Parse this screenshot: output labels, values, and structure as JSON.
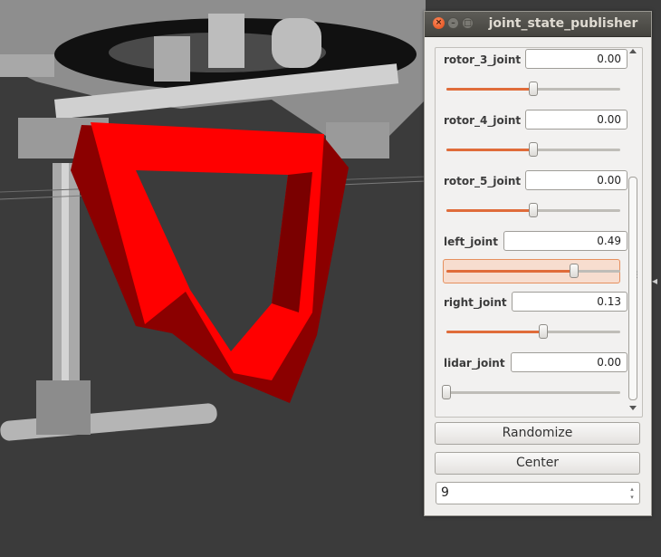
{
  "window": {
    "title": "joint_state_publisher",
    "close_glyph": "×",
    "min_glyph": "–",
    "max_glyph": "□"
  },
  "joints": [
    {
      "name": "rotor_3_joint",
      "value": "0.00",
      "level": 0.5
    },
    {
      "name": "rotor_4_joint",
      "value": "0.00",
      "level": 0.5
    },
    {
      "name": "rotor_5_joint",
      "value": "0.00",
      "level": 0.5
    },
    {
      "name": "left_joint",
      "value": "0.49",
      "level": 0.735,
      "focused": true
    },
    {
      "name": "right_joint",
      "value": "0.13",
      "level": 0.555
    },
    {
      "name": "lidar_joint",
      "value": "0.00",
      "level": 0.0
    }
  ],
  "buttons": {
    "randomize": "Randomize",
    "center": "Center"
  },
  "spinbox": {
    "value": "9",
    "up_glyph": "▴",
    "down_glyph": "▾"
  },
  "icons": {
    "splitter": "splitter-grip-icon",
    "scroll_up": "scroll-up-arrow-icon",
    "scroll_down": "scroll-down-arrow-icon"
  },
  "colors": {
    "accent": "#e06c3a",
    "robot_frame": "#ff0000",
    "titlebar": "#4f4e4a",
    "viewport_bg": "#3a3a3a"
  }
}
